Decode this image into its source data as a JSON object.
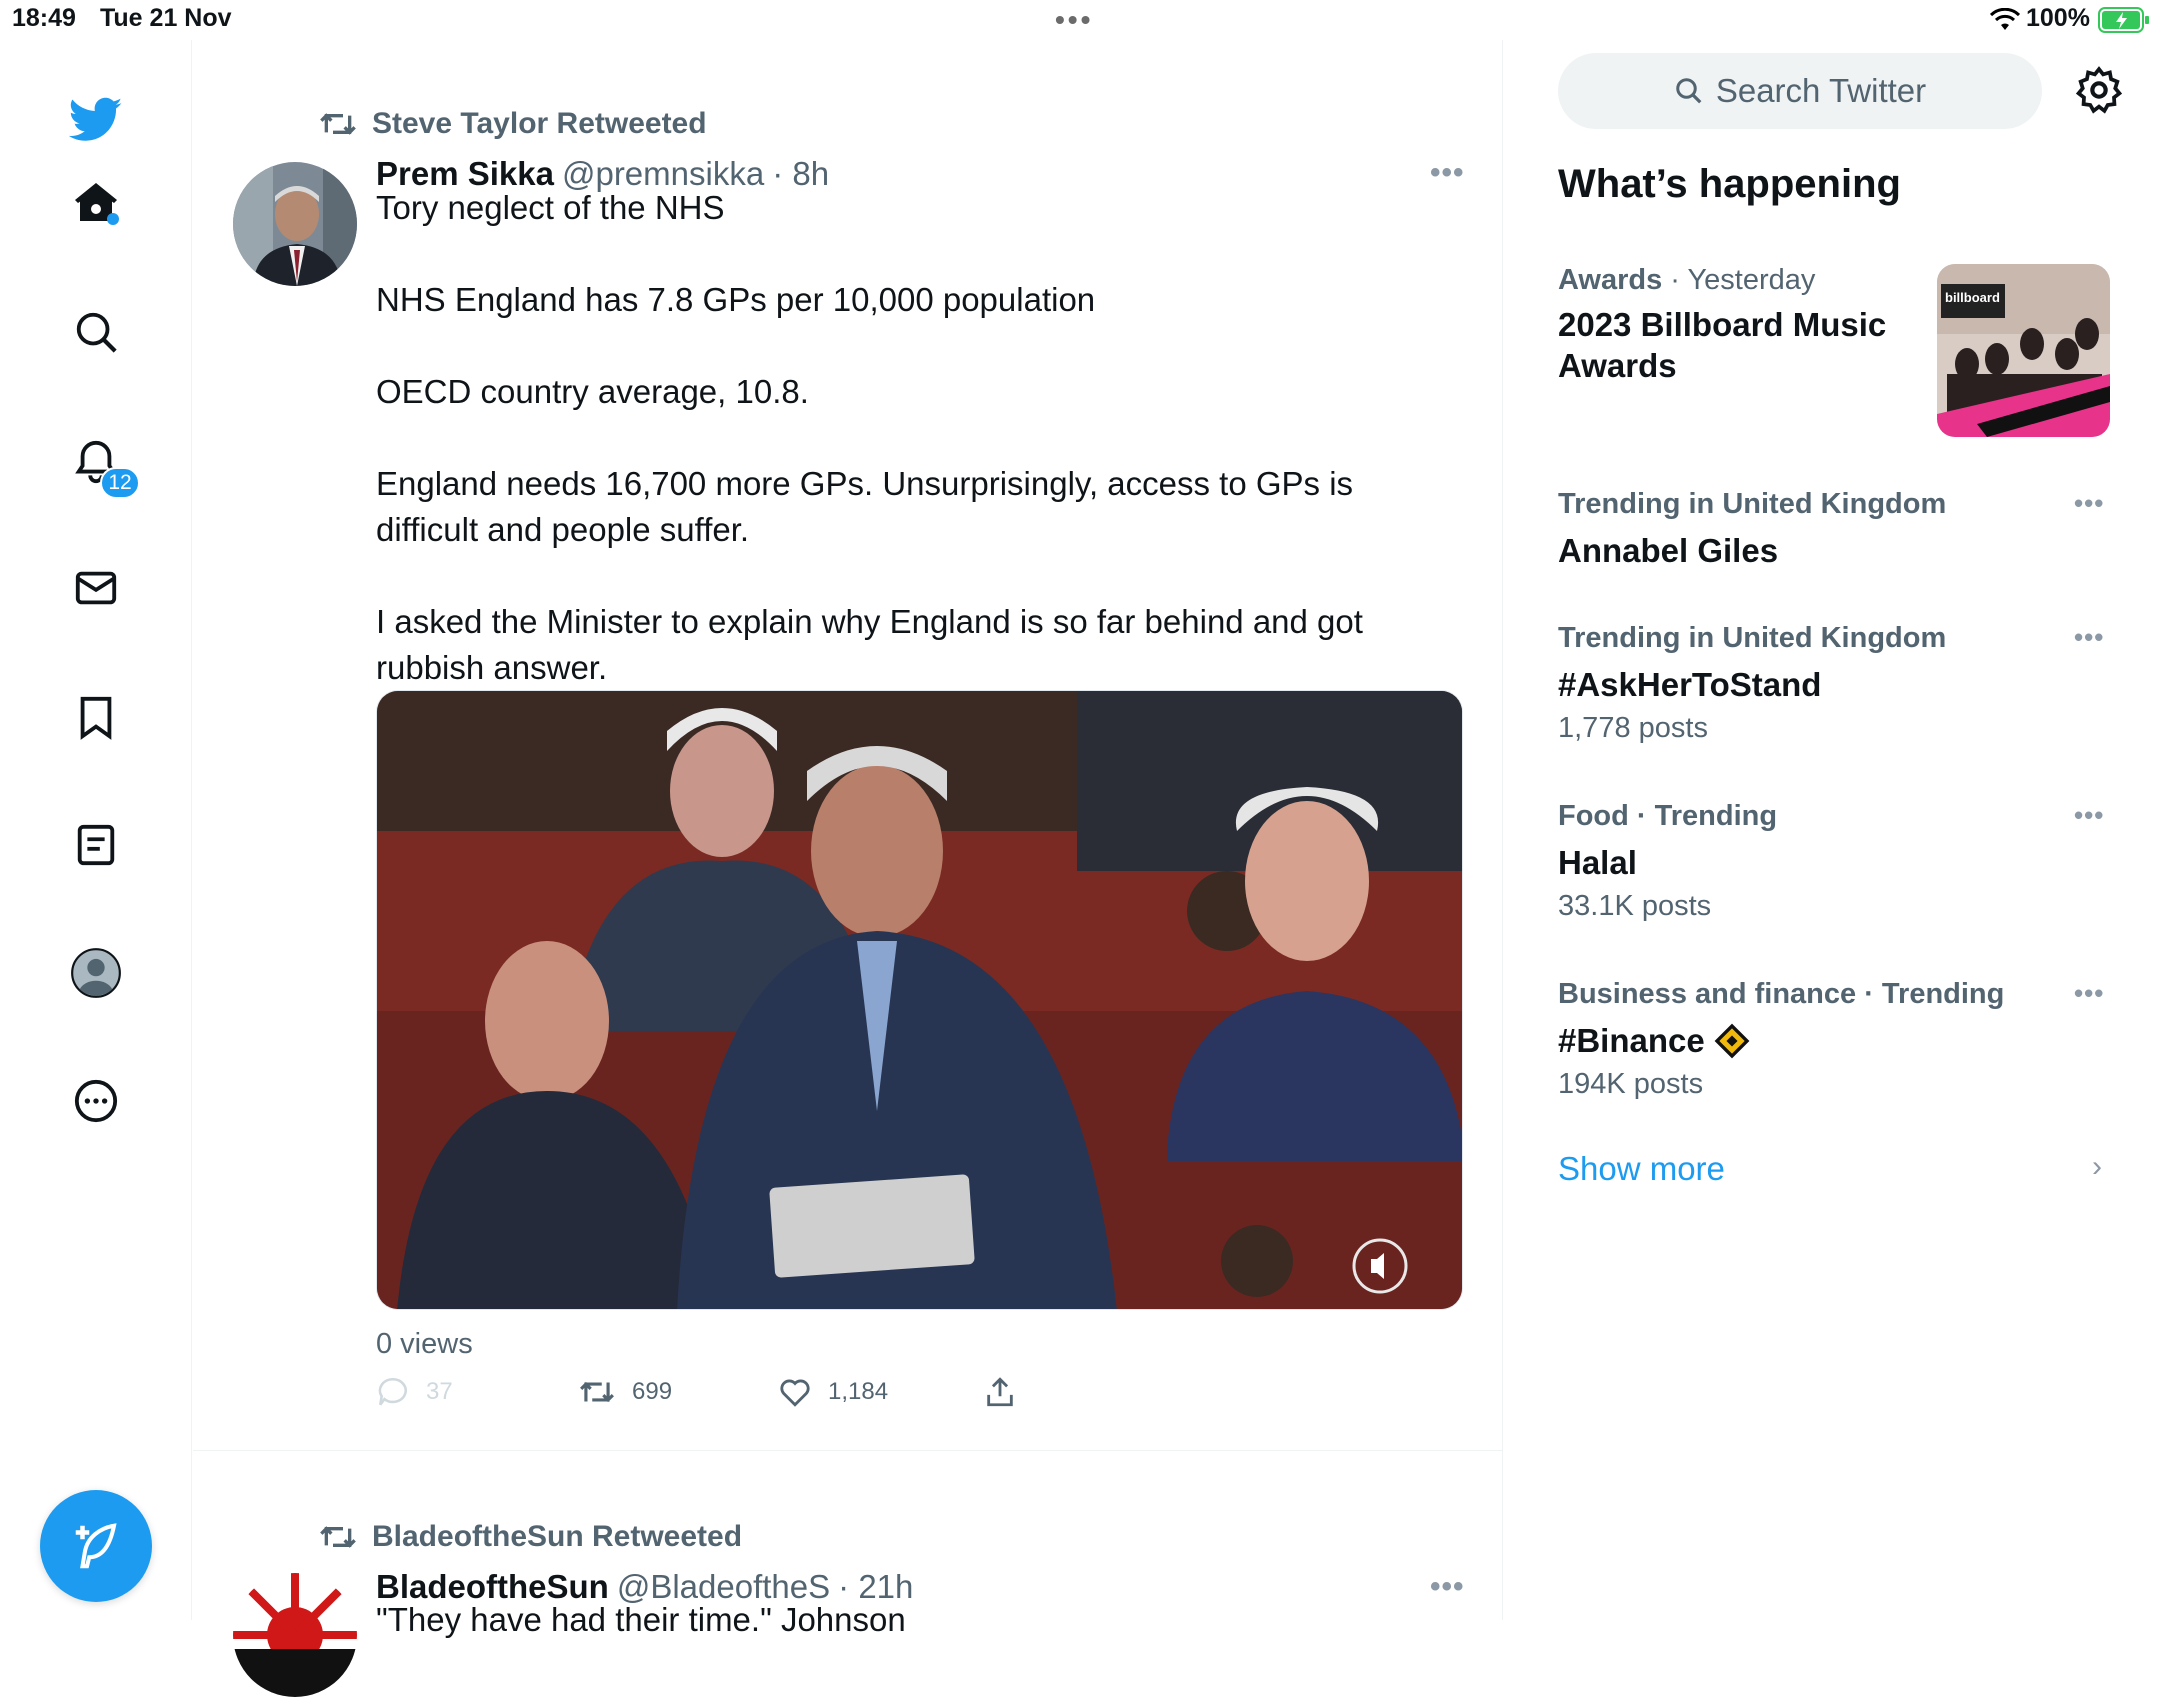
{
  "status_bar": {
    "time": "18:49",
    "date": "Tue 21 Nov",
    "battery": "100%"
  },
  "sidebar": {
    "notifications_badge": "12"
  },
  "tweets": [
    {
      "retweeted_by": "Steve Taylor Retweeted",
      "name": "Prem Sikka",
      "handle": "@premnsikka",
      "time": "· 8h",
      "text": [
        "Tory neglect of the NHS",
        "NHS England has 7.8 GPs per 10,000 population",
        "OECD country average, 10.8.",
        "England needs 16,700 more GPs. Unsurprisingly, access to GPs is difficult and people suffer.",
        "I asked the Minister to explain why England is so far behind and got rubbish answer."
      ],
      "views": "0 views",
      "replies": "37",
      "retweets": "699",
      "likes": "1,184"
    },
    {
      "retweeted_by": "BladeoftheSun Retweeted",
      "name": "BladeoftheSun",
      "handle": "@BladeoftheS",
      "time": "· 21h",
      "text": [
        "\"They have had their time.\" Johnson"
      ]
    }
  ],
  "right": {
    "search_placeholder": "Search Twitter",
    "heading": "What’s happening",
    "trends": [
      {
        "category": "Awards",
        "sep": " · Yesterday",
        "title": "2023 Billboard Music Awards",
        "count": ""
      },
      {
        "category": "Trending in United Kingdom",
        "sep": "",
        "title": "Annabel Giles",
        "count": ""
      },
      {
        "category": "Trending in United Kingdom",
        "sep": "",
        "title": "#AskHerToStand",
        "count": "1,778 posts"
      },
      {
        "category": "Food · Trending",
        "sep": "",
        "title": "Halal",
        "count": "33.1K posts"
      },
      {
        "category": "Business and finance · Trending",
        "sep": "",
        "title": "#Binance",
        "count": "194K posts"
      }
    ],
    "show_more": "Show more",
    "thumb_text": "billboard"
  },
  "colors": {
    "accent": "#1d9bf0",
    "text_secondary": "#536471"
  }
}
